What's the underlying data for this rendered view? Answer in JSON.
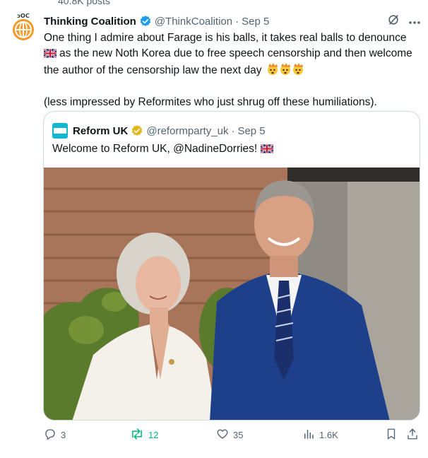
{
  "top_count": "40.8K posts",
  "tweet": {
    "author_name": "Thinking Coalition",
    "handle": "@ThinkCoalition",
    "separator": "·",
    "date": "Sep 5",
    "paragraph1_a": "One thing I admire about Farage is his balls, it takes real balls to denounce",
    "paragraph1_b": "as the new Noth Korea due to free speech censorship and then welcome the author of the censorship law the next day",
    "paragraph2": "(less impressed by Reformites who just shrug off these humiliations).",
    "grok_icon": "grok-slash-icon",
    "more_icon": "more-dots-icon"
  },
  "quote": {
    "author_name": "Reform UK",
    "handle": "@reformparty_uk",
    "separator": "·",
    "date": "Sep 5",
    "text": "Welcome to Reform UK, @NadineDorries!",
    "photo_icon": "photo-two-people"
  },
  "actions": {
    "replies": "3",
    "retweets": "12",
    "likes": "35",
    "views": "1.6K"
  },
  "colors": {
    "verified_blue": "#1d9bf0",
    "verified_gold": "#e2b719",
    "retweet_green": "#00ba7c",
    "muted": "#536471"
  }
}
